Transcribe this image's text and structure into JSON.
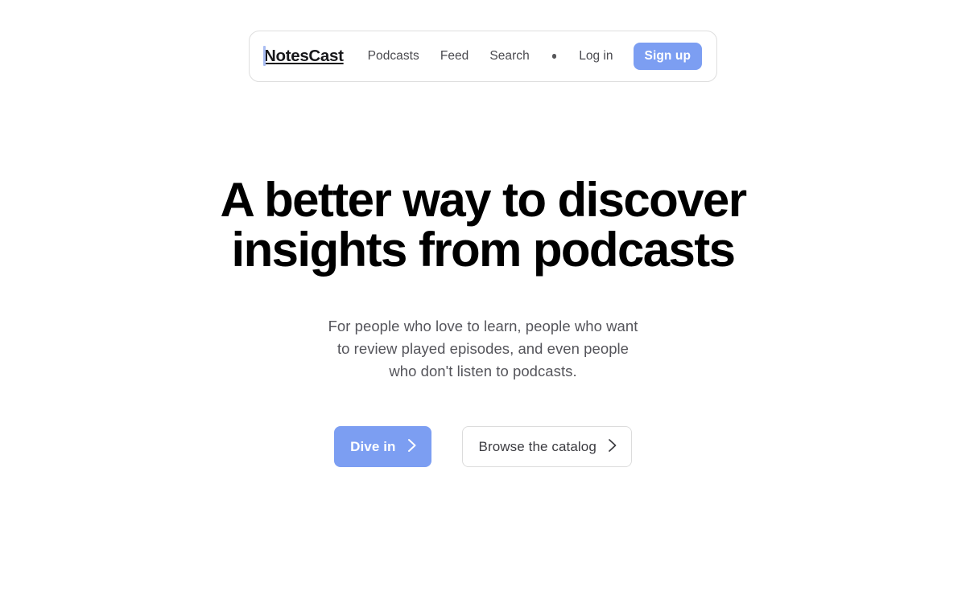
{
  "page": {
    "background_color": "#ffffff",
    "accent_color": "#7c9ef2",
    "text_color": "#000000",
    "muted_text_color": "#55555b"
  },
  "navbar": {
    "brand": {
      "accent_letter": "N",
      "rest": "otesCast",
      "full": "NotesCast",
      "accent_bar_color": "#a9bdf2"
    },
    "links": [
      {
        "label": "Podcasts",
        "name": "nav-link-podcasts"
      },
      {
        "label": "Feed",
        "name": "nav-link-feed"
      },
      {
        "label": "Search",
        "name": "nav-link-search"
      }
    ],
    "separator_icon": "dot-separator-icon",
    "login_label": "Log in",
    "signup_label": "Sign up",
    "signup_color": "#7c9ef2"
  },
  "hero": {
    "headline_line1": "A better way to discover",
    "headline_line2": "insights from podcasts",
    "subhead_line1": "For people who love to learn, people who want",
    "subhead_line2": "to review played episodes, and even people",
    "subhead_line3": "who don't listen to podcasts.",
    "primary_cta": {
      "label": "Dive in",
      "icon": "chevron-right-icon",
      "color": "#7c9ef2"
    },
    "secondary_cta": {
      "label": "Browse the catalog",
      "icon": "chevron-right-icon",
      "border_color": "#dcdcdc"
    }
  }
}
